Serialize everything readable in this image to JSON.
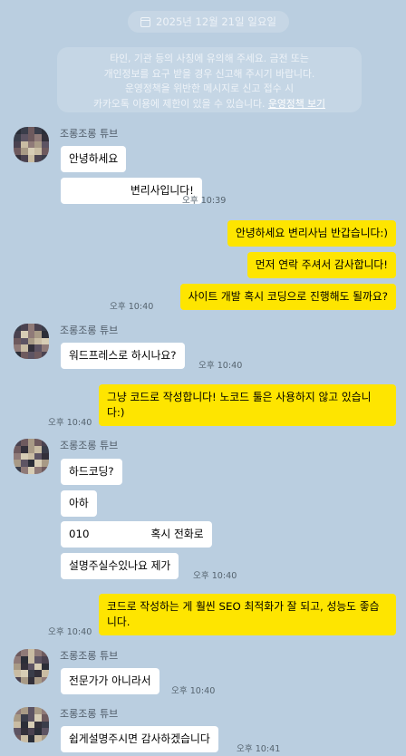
{
  "date_divider": "2025년 12월 21일 일요일",
  "notice": {
    "lines": [
      "타인, 기관 등의 사칭에 유의해 주세요. 금전 또는",
      "개인정보를 요구 받을 경우 신고해 주시기 바랍니다.",
      "운영정책을 위반한 메시지로 신고 접수 시",
      "카카오톡 이용에 제한이 있을 수 있습니다."
    ],
    "link": "운영정책 보기"
  },
  "sender_name": "조롱조롱 튜브",
  "messages": [
    {
      "text": "안녕하세요",
      "time": ""
    },
    {
      "text": "변리사입니다!",
      "time": "오후 10:39"
    },
    {
      "text": "안녕하세요 변리사님 반갑습니다:)",
      "time": ""
    },
    {
      "text": "먼저 연락 주셔서 감사합니다!",
      "time": ""
    },
    {
      "text": "사이트 개발 혹시 코딩으로 진행해도 될까요?",
      "time": "오후 10:40"
    },
    {
      "text": "워드프레스로 하시나요?",
      "time": "오후 10:40"
    },
    {
      "text": "그냥 코드로 작성합니다! 노코드 툴은 사용하지 않고 있습니다:)",
      "time": "오후 10:40"
    },
    {
      "text": "하드코딩?",
      "time": ""
    },
    {
      "text": "아하",
      "time": ""
    },
    {
      "text_a": "010",
      "text_b": "혹시 전화로",
      "time": ""
    },
    {
      "text": "설명주실수있나요 제가",
      "time": "오후 10:40"
    },
    {
      "text": "코드로 작성하는 게 훨씬 SEO 최적화가 잘 되고, 성능도 좋습니다.",
      "time": "오후 10:40"
    },
    {
      "text": "전문가가 아니라서",
      "time": "오후 10:40"
    },
    {
      "text": "쉽게설명주시면 감사하겠습니다",
      "time": "오후 10:41"
    }
  ],
  "colors": {
    "background": "#bacee0",
    "outgoing_bubble": "#fee500",
    "incoming_bubble": "#ffffff"
  }
}
